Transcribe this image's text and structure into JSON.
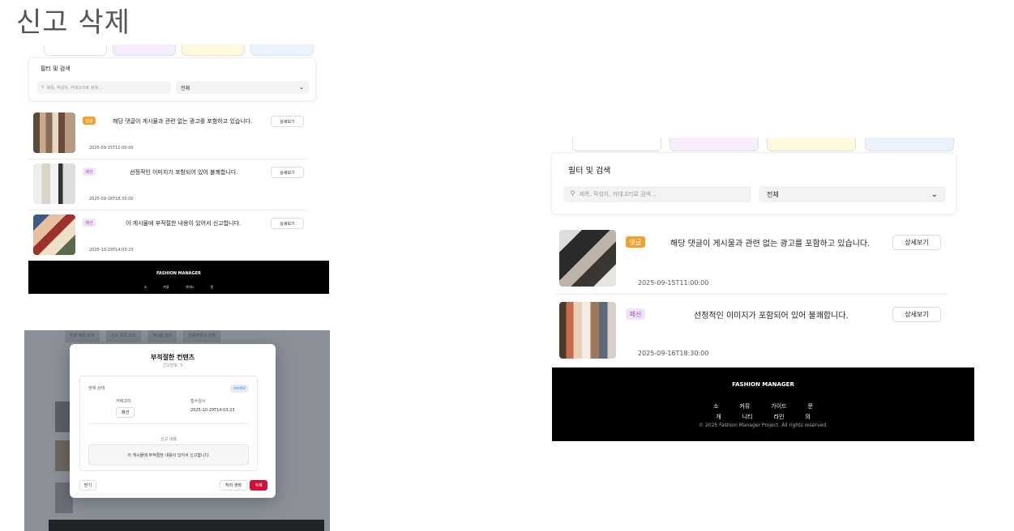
{
  "page_title": "신고 삭제",
  "filter": {
    "title": "필터 및 검색",
    "search_placeholder": "제목, 작성자, 카테고리로 검색...",
    "select_value": "전체"
  },
  "left_reports": [
    {
      "badge": "댓글",
      "badge_type": "comment",
      "text": "해당 댓글이 게시물과 관련 없는 광고를 포함하고 있습니다.",
      "date": "2025-09-15T11:00:00",
      "detail": "상세보기"
    },
    {
      "badge": "패션",
      "badge_type": "fashion",
      "text": "선정적인 이미지가 포함되어 있어 불쾌합니다.",
      "date": "2025-09-16T18:30:00",
      "detail": "상세보기"
    },
    {
      "badge": "패션",
      "badge_type": "fashion",
      "text": "이 게시물에 부적절한 내용이 있어서 신고합니다.",
      "date": "2025-10-29T14:03:23",
      "detail": "상세보기"
    }
  ],
  "right_reports": [
    {
      "badge": "댓글",
      "badge_type": "comment",
      "text": "해당 댓글이 게시물과 관련 없는 광고를 포함하고 있습니다.",
      "date": "2025-09-15T11:00:00",
      "detail": "상세보기"
    },
    {
      "badge": "패션",
      "badge_type": "fashion",
      "text": "선정적인 이미지가 포함되어 있어 불쾌합니다.",
      "date": "2025-09-16T18:30:00",
      "detail": "상세보기"
    }
  ],
  "footer": {
    "brand": "FASHION MANAGER",
    "links_row1": [
      "소",
      "커뮤",
      "가이드",
      "문"
    ],
    "links_row2": [
      "개",
      "니티",
      "라인",
      "의"
    ],
    "copyright": "© 2025 Fashion Manager Project. All rights reserved."
  },
  "left_footer_links": [
    "소",
    "커뮤",
    "가이드",
    "문"
  ],
  "modal": {
    "bg_tabs": [
      "전체 회원 조회",
      "신고 목록 조회",
      "게시물 조회",
      "전용쿠폰의 신청"
    ],
    "title": "부적절한 컨텐츠",
    "subtitle": "신고번호: 3",
    "status_label": "현재 상태",
    "status_badge": "처리완료",
    "category_label": "카테고리",
    "category_value": "패션",
    "date_label": "접수일시",
    "date_value": "2025-10-29T14:03:23",
    "content_label": "신고 내용",
    "content_text": "이 게시물에 부적절한 내용이 있어서 신고합니다.",
    "close_button": "닫기",
    "cancel_button": "처리 생략",
    "delete_button": "삭제"
  },
  "colors": {
    "accent_red": "#d0103a",
    "badge_comment": "#f0a030",
    "badge_fashion_bg": "#f0e3fb",
    "tab_purple": "#f6eefc",
    "tab_yellow": "#fef9dc",
    "tab_blue": "#eaf2fd"
  }
}
